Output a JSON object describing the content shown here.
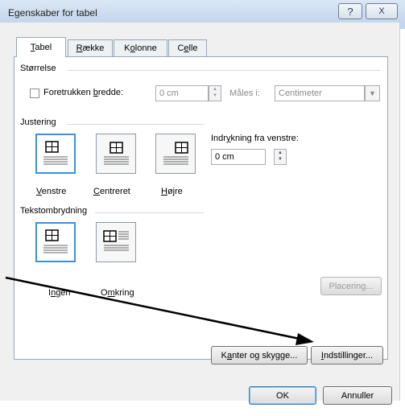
{
  "window": {
    "title": "Egenskaber for tabel",
    "help_glyph": "?",
    "close_glyph": "X"
  },
  "tabs": [
    {
      "pre": "",
      "key": "T",
      "post": "abel"
    },
    {
      "pre": "",
      "key": "R",
      "post": "ække"
    },
    {
      "pre": "K",
      "key": "o",
      "post": "lonne"
    },
    {
      "pre": "C",
      "key": "e",
      "post": "lle"
    }
  ],
  "size": {
    "heading": "Størrelse",
    "checkbox": {
      "pre": "Foretrukken ",
      "key": "b",
      "post": "redde:",
      "checked": false
    },
    "width_value": "0 cm",
    "measure_label": "Måles i:",
    "measure_value": "Centimeter"
  },
  "alignment": {
    "heading": "Justering",
    "options": [
      {
        "pre": "",
        "key": "V",
        "post": "enstre",
        "selected": true
      },
      {
        "pre": "",
        "key": "C",
        "post": "entreret",
        "selected": false
      },
      {
        "pre": "",
        "key": "H",
        "post": "øjre",
        "selected": false
      }
    ],
    "indent_label": {
      "pre": "Indr",
      "key": "y",
      "post": "kning fra venstre:"
    },
    "indent_value": "0 cm"
  },
  "wrapping": {
    "heading": "Tekstombrydning",
    "options": [
      {
        "pre": "I",
        "key": "n",
        "post": "gen",
        "selected": true
      },
      {
        "pre": "O",
        "key": "m",
        "post": "kring",
        "selected": false
      }
    ],
    "positioning_label": "Placering..."
  },
  "buttons": {
    "borders": {
      "pre": "K",
      "key": "a",
      "post": "nter og skygge..."
    },
    "options": {
      "pre": "",
      "key": "I",
      "post": "ndstillinger..."
    },
    "ok": "OK",
    "cancel": "Annuller"
  },
  "annotation": {
    "color": "#000000"
  }
}
